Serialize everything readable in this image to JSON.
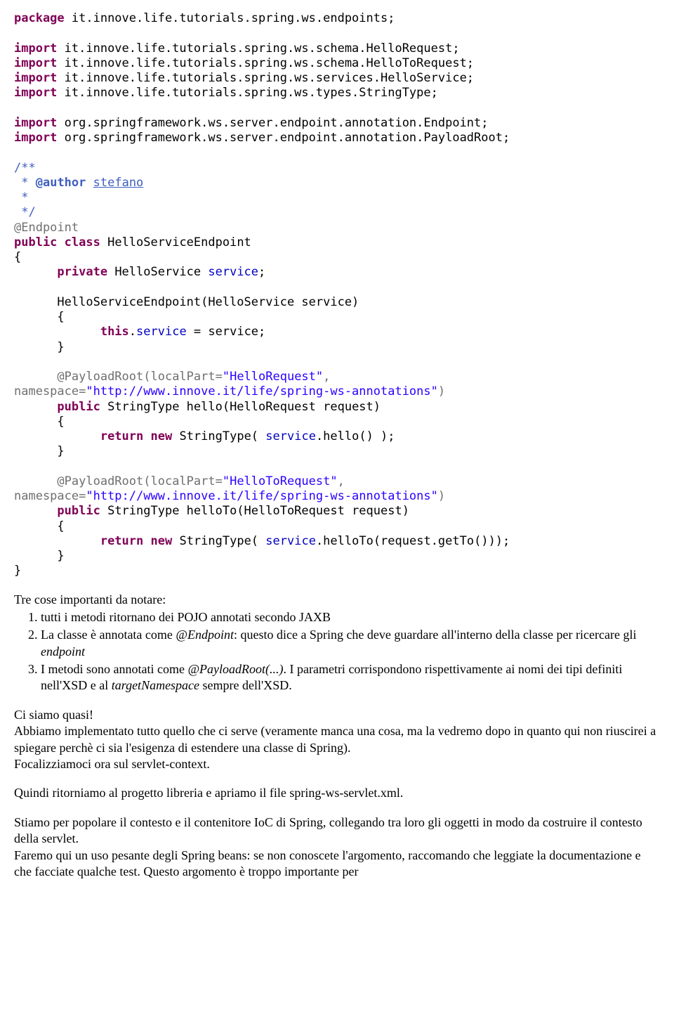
{
  "code": {
    "l01a": "package",
    "l01b": " it.innove.life.tutorials.spring.ws.endpoints;",
    "l02a": "import",
    "l02b": " it.innove.life.tutorials.spring.ws.schema.HelloRequest;",
    "l03a": "import",
    "l03b": " it.innove.life.tutorials.spring.ws.schema.HelloToRequest;",
    "l04a": "import",
    "l04b": " it.innove.life.tutorials.spring.ws.services.HelloService;",
    "l05a": "import",
    "l05b": " it.innove.life.tutorials.spring.ws.types.StringType;",
    "l06a": "import",
    "l06b": " org.springframework.ws.server.endpoint.annotation.Endpoint;",
    "l07a": "import",
    "l07b": " org.springframework.ws.server.endpoint.annotation.PayloadRoot;",
    "jd1": "/**",
    "jd2": " * ",
    "jd_tag": "@author",
    "jd_author_sp": " ",
    "jd_author": "stefano",
    "jd3": " *",
    "jd4": " */",
    "ann_endpoint": "@Endpoint",
    "pub": "public",
    "cls": "class",
    "clsname": " HelloServiceEndpoint",
    "lbrace": "{",
    "rbrace": "}",
    "priv": "private",
    "svc_decl": " HelloService ",
    "svc_field": "service",
    "semi": ";",
    "ctor_sig": "      HelloServiceEndpoint(HelloService service)",
    "ctor_lb": "      {",
    "ctor_this": "this",
    "ctor_assign_a": ".",
    "ctor_assign_b": " = service;",
    "ctor_rb": "      }",
    "pr_ann": "@PayloadRoot",
    "pr1_args_a": "(localPart=",
    "pr1_str1": "\"HelloRequest\"",
    "pr1_args_b": ", ",
    "pr_ns_lhs": "namespace=",
    "pr_ns_str": "\"http://www.innove.it/life/spring-ws-annotations\"",
    "pr_close": ")",
    "m1_sig": " StringType hello(HelloRequest request)",
    "m_lb": "      {",
    "ret": "return",
    "new": "new",
    "m1_ret_a": " StringType( ",
    "m1_ret_svc": "service",
    "m1_ret_b": ".hello() );",
    "m_rb": "      }",
    "pr2_args_a": "(localPart=",
    "pr2_str1": "\"HelloToRequest\"",
    "m2_sig": " StringType helloTo(HelloToRequest request)",
    "m2_ret_a": " StringType( ",
    "m2_ret_svc": "service",
    "m2_ret_b": ".helloTo(request.getTo()));",
    "indent6": "      ",
    "indent12": "            "
  },
  "prose": {
    "p1_intro": "Tre cose importanti da notare:",
    "li1": "tutti i metodi ritornano dei POJO annotati secondo JAXB",
    "li2a": "La classe è annotata come ",
    "li2_em": "@Endpoint",
    "li2b": ": questo dice a Spring che deve guardare all'interno della classe per ricercare gli ",
    "li2_em2": "endpoint",
    "li3a": "I metodi sono annotati come ",
    "li3_em": "@PayloadRoot(...)",
    "li3b": ". I parametri corrispondono rispettivamente ai nomi dei tipi definiti nell'XSD e al ",
    "li3_em2": "targetNamespace",
    "li3c": " sempre dell'XSD.",
    "p2a": "Ci siamo quasi!",
    "p2b": "Abbiamo implementato tutto quello che ci serve (veramente manca una cosa, ma la vedremo dopo in quanto qui non riuscirei a spiegare perchè ci sia l'esigenza di estendere una classe di Spring).",
    "p2c": "Focalizziamoci ora sul servlet-context.",
    "p3": "Quindi ritorniamo al progetto libreria e apriamo il file spring-ws-servlet.xml.",
    "p4a": "Stiamo per popolare il contesto e il contenitore IoC di Spring, collegando tra loro gli oggetti in modo da costruire il contesto della servlet.",
    "p4b": "Faremo qui un uso pesante degli Spring beans: se non conoscete l'argomento, raccomando che leggiate la documentazione e che facciate qualche test. Questo argomento è troppo importante per"
  }
}
